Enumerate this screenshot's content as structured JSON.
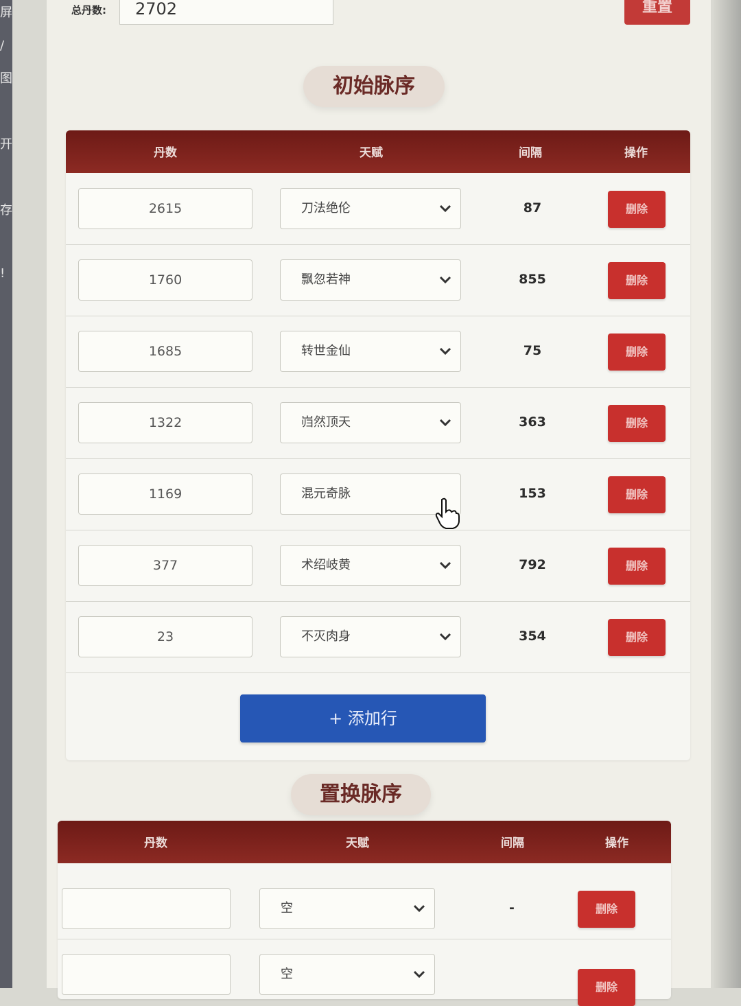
{
  "top": {
    "total_label": "总丹数:",
    "total_value": "2702",
    "reset_label": "重置"
  },
  "initial": {
    "title": "初始脉序",
    "headers": {
      "dan": "丹数",
      "talent": "天赋",
      "gap": "间隔",
      "action": "操作"
    },
    "rows": [
      {
        "dan": "2615",
        "talent": "刀法绝伦",
        "gap": "87",
        "delete": "删除"
      },
      {
        "dan": "1760",
        "talent": "飘忽若神",
        "gap": "855",
        "delete": "删除"
      },
      {
        "dan": "1685",
        "talent": "转世金仙",
        "gap": "75",
        "delete": "删除"
      },
      {
        "dan": "1322",
        "talent": "岿然顶天",
        "gap": "363",
        "delete": "删除"
      },
      {
        "dan": "1169",
        "talent": "混元奇脉",
        "gap": "153",
        "delete": "删除"
      },
      {
        "dan": "377",
        "talent": "术绍岐黄",
        "gap": "792",
        "delete": "删除"
      },
      {
        "dan": "23",
        "talent": "不灭肉身",
        "gap": "354",
        "delete": "删除"
      }
    ],
    "add_row_label": "+ 添加行"
  },
  "replace": {
    "title": "置换脉序",
    "headers": {
      "dan": "丹数",
      "talent": "天赋",
      "gap": "间隔",
      "action": "操作"
    },
    "rows": [
      {
        "dan": "",
        "talent": "空",
        "gap": "-",
        "delete": "删除"
      },
      {
        "dan": "",
        "talent": "空",
        "gap": "",
        "delete": "删除"
      }
    ]
  },
  "left_strip": [
    "屏",
    "/",
    "图",
    "开",
    "存",
    "!"
  ],
  "colors": {
    "header": "#7a1f1a",
    "delete": "#c8302d",
    "add": "#2657b5"
  }
}
